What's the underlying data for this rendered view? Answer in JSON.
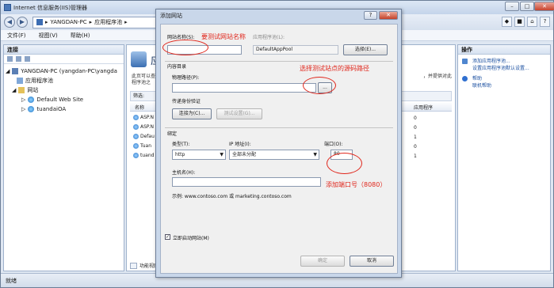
{
  "window": {
    "title": "Internet 信息服务(IIS)管理器"
  },
  "address": {
    "crumbs": [
      "YANGDAN-PC",
      "应用程序池"
    ]
  },
  "menu": {
    "file": "文件(F)",
    "view": "视图(V)",
    "help": "帮助(H)"
  },
  "left": {
    "header": "连接",
    "tree": [
      "YANGDAN-PC (yangdan-PC\\yangda",
      "应用程序池",
      "网站",
      "Default Web Site",
      "tuandaiOA"
    ]
  },
  "middle": {
    "title": "应",
    "desc_left_1": "此页可以查",
    "desc_left_2": "程序池之",
    "desc_right": "，并提供对此",
    "filter_label": "筛选:",
    "columns": {
      "name": "名称",
      "apps": "应用程序"
    },
    "rows": [
      {
        "name": "ASP.N",
        "apps": "0"
      },
      {
        "name": "ASP.N",
        "apps": "0"
      },
      {
        "name": "Defau",
        "apps": "1"
      },
      {
        "name": "Tuan",
        "apps": "0"
      },
      {
        "name": "tuand",
        "apps": "1"
      }
    ],
    "view_label": "功能视图"
  },
  "right": {
    "header": "操作",
    "actions": [
      "添加应用程序池...",
      "设置应用程序池默认设置...",
      "帮助",
      "联机帮助"
    ]
  },
  "status": {
    "text": "就绪"
  },
  "dialog": {
    "title": "添加网站",
    "site_name_label": "网站名称(S):",
    "app_pool_label": "应用程序池(L):",
    "app_pool_value": "DefaultAppPool",
    "select_button": "选择(E)...",
    "content_dir_label": "内容目录",
    "physical_path_label": "物理路径(P):",
    "browse_button": "...",
    "passthrough_label": "传递身份验证",
    "connect_as_button": "连接为(C)...",
    "test_settings_button": "测试设置(G)...",
    "binding_label": "绑定",
    "type_label": "类型(T):",
    "type_value": "http",
    "ip_label": "IP 地址(I):",
    "ip_value": "全部未分配",
    "port_label": "端口(O):",
    "port_value": "80",
    "host_label": "主机名(H):",
    "example_text": "示例: www.contoso.com 或 marketing.contoso.com",
    "start_immediately_label": "立即启动网站(M)",
    "ok_button": "确定",
    "cancel_button": "取消"
  },
  "annotations": {
    "site_name_hint": "要测试网站名称",
    "path_hint": "选择测试站点的源码路径",
    "port_hint": "添加端口号（8080）"
  },
  "colors": {
    "annotation": "#e0261b",
    "accent": "#3b6fb2"
  }
}
